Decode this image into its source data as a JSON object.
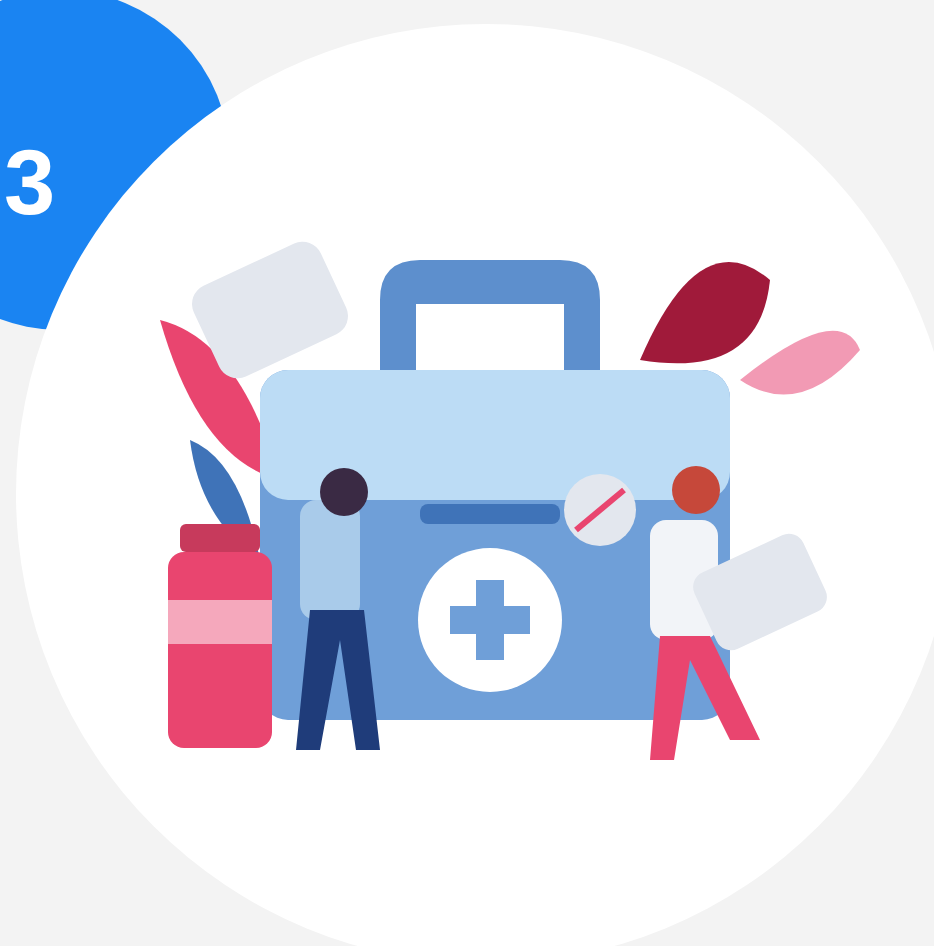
{
  "step_badge": {
    "number": "3"
  }
}
